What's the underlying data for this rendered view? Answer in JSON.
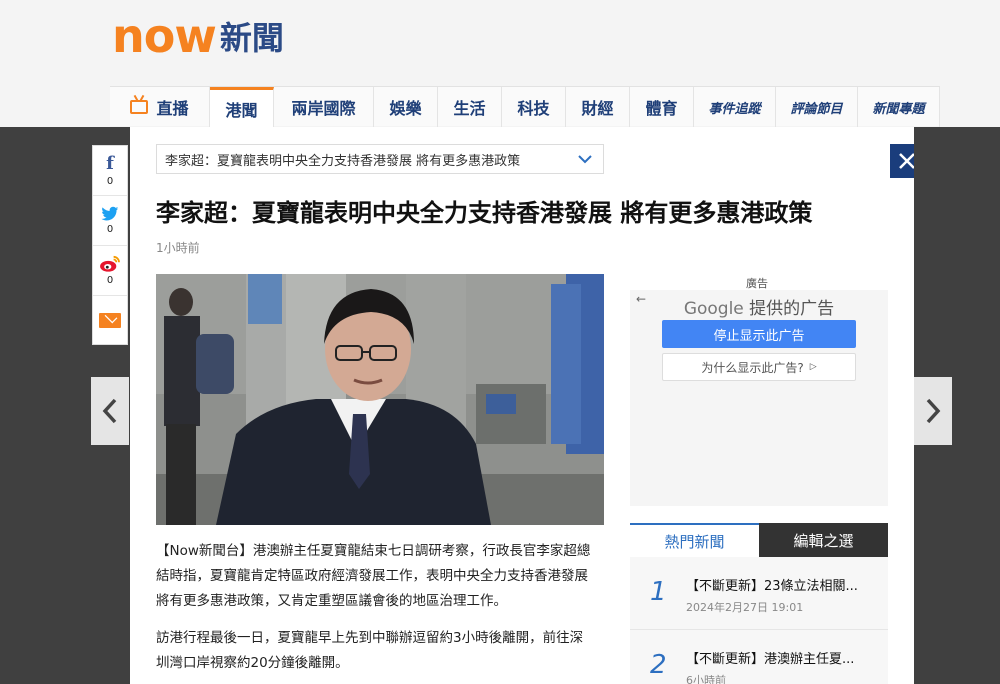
{
  "header": {
    "logo_now": "now",
    "logo_cn": "新聞"
  },
  "nav": {
    "items": [
      {
        "label": "直播"
      },
      {
        "label": "港聞"
      },
      {
        "label": "兩岸國際"
      },
      {
        "label": "娛樂"
      },
      {
        "label": "生活"
      },
      {
        "label": "科技"
      },
      {
        "label": "財經"
      },
      {
        "label": "體育"
      },
      {
        "label": "事件追蹤"
      },
      {
        "label": "評論節目"
      },
      {
        "label": "新聞專題"
      }
    ]
  },
  "share": {
    "facebook_count": "0",
    "twitter_count": "0",
    "weibo_count": "0"
  },
  "article": {
    "dropdown_text": "李家超：夏寶龍表明中央全力支持香港發展 將有更多惠港政策",
    "headline": "李家超：夏寶龍表明中央全力支持香港發展 將有更多惠港政策",
    "timestamp": "1小時前",
    "paragraphs": [
      "【Now新聞台】港澳辦主任夏寶龍結束七日調研考察，行政長官李家超總結時指，夏寶龍肯定特區政府經濟發展工作，表明中央全力支持香港發展將有更多惠港政策，又肯定重塑區議會後的地區治理工作。",
      "訪港行程最後一日，夏寶龍早上先到中聯辦逗留約3小時後離開，前往深圳灣口岸視察約20分鐘後離開。"
    ]
  },
  "ad": {
    "label": "廣告",
    "back": "←",
    "google": "Google",
    "provided": "提供的广告",
    "stop": "停止显示此广告",
    "why": "为什么显示此广告?"
  },
  "hot_news": {
    "tab_hot": "熱門新聞",
    "tab_editor": "編輯之選",
    "items": [
      {
        "num": "1",
        "title": "【不斷更新】23條立法相關...",
        "date": "2024年2月27日 19:01"
      },
      {
        "num": "2",
        "title": "【不斷更新】港澳辦主任夏...",
        "date": "6小時前"
      }
    ]
  },
  "colors": {
    "brand_orange": "#f58220",
    "brand_blue": "#1a3d7c",
    "link_blue": "#2d6fc0"
  }
}
